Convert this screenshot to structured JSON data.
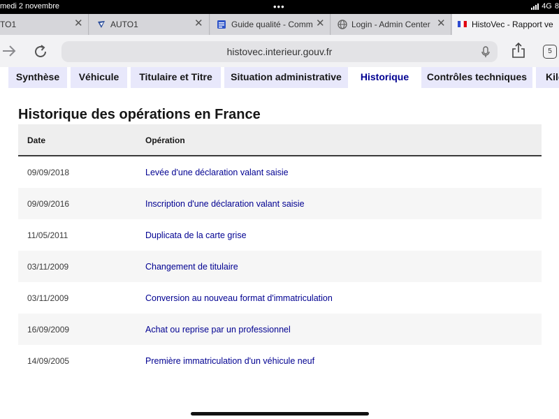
{
  "status_bar": {
    "date": "medi 2 novembre",
    "dots": "•••",
    "network": "4G",
    "battery": "8"
  },
  "browser_tabs": [
    {
      "label": "TO1"
    },
    {
      "label": "AUTO1"
    },
    {
      "label": "Guide qualité - Comm"
    },
    {
      "label": "Login - Admin Center"
    },
    {
      "label": "HistoVec - Rapport ve"
    }
  ],
  "toolbar": {
    "url": "histovec.interieur.gouv.fr",
    "tab_count": "5"
  },
  "nav_tabs": [
    {
      "label": "Synthèse"
    },
    {
      "label": "Véhicule"
    },
    {
      "label": "Titulaire et Titre"
    },
    {
      "label": "Situation administrative"
    },
    {
      "label": "Historique"
    },
    {
      "label": "Contrôles techniques"
    },
    {
      "label": "Kilo"
    }
  ],
  "active_nav_tab": "Historique",
  "section_title": "Historique des opérations en France",
  "table": {
    "headers": [
      "Date",
      "Opération"
    ],
    "rows": [
      {
        "date": "09/09/2018",
        "operation": "Levée d'une déclaration valant saisie"
      },
      {
        "date": "09/09/2016",
        "operation": "Inscription d'une déclaration valant saisie"
      },
      {
        "date": "11/05/2011",
        "operation": "Duplicata de la carte grise"
      },
      {
        "date": "03/11/2009",
        "operation": "Changement de titulaire"
      },
      {
        "date": "03/11/2009",
        "operation": "Conversion au nouveau format d'immatriculation"
      },
      {
        "date": "16/09/2009",
        "operation": "Achat ou reprise par un professionnel"
      },
      {
        "date": "14/09/2005",
        "operation": "Première immatriculation d'un véhicule neuf"
      }
    ]
  },
  "colors": {
    "accent": "#000091",
    "nav_tab_bg": "#e8e8fb",
    "row_alt_bg": "#f6f6f6"
  },
  "icons": [
    "back-arrow-icon",
    "reload-icon",
    "microphone-icon",
    "share-icon",
    "close-icon",
    "globe-icon",
    "french-flag-icon",
    "document-icon",
    "site-logo-icon"
  ]
}
